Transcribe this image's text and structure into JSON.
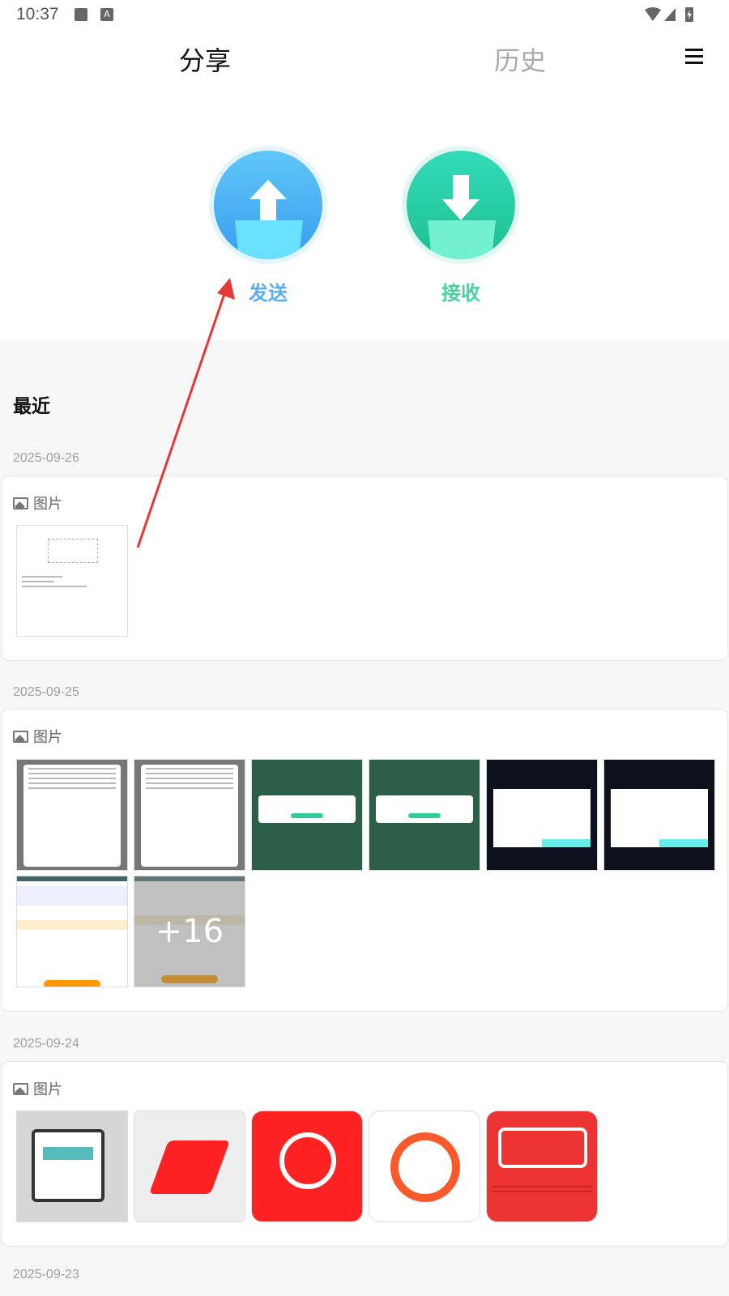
{
  "status_bar": {
    "time": "10:37"
  },
  "tabs": [
    {
      "label": "分享",
      "active": true
    },
    {
      "label": "历史",
      "active": false
    }
  ],
  "actions": {
    "send": "发送",
    "receive": "接收"
  },
  "recent_title": "最近",
  "groups": [
    {
      "date": "2025-09-26",
      "type": "图片",
      "count": 1
    },
    {
      "date": "2025-09-25",
      "type": "图片",
      "count": 24,
      "more_label": "+16"
    },
    {
      "date": "2025-09-24",
      "type": "图片",
      "count": 5
    },
    {
      "date": "2025-09-23"
    }
  ],
  "colors": {
    "send": "#5aaef0",
    "receive": "#4fcf9f",
    "annotation": "#e53935"
  }
}
